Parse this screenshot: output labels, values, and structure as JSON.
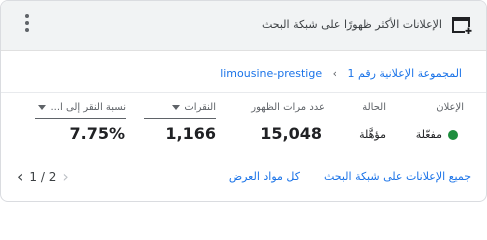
{
  "header": {
    "title": "الإعلانات الأكثر ظهورًا على شبكة البحث",
    "icon": "add-to-queue-icon"
  },
  "breadcrumb": {
    "campaign": "limousine-prestige",
    "separator": "›",
    "ad_group": "المجموعة الإعلانية رقم 1"
  },
  "columns": {
    "ad": "الإعلان",
    "status": "الحالة",
    "impressions": "عدد مرات الظهور",
    "clicks": "النقرات",
    "ctr": "نسبة النقر إلى ا..."
  },
  "row": {
    "ad_status": "مفعّلة",
    "status": "مؤهَّلة",
    "impressions": "15,048",
    "clicks": "1,166",
    "ctr": "7.75%"
  },
  "footer": {
    "all_search_ads": "جميع الإعلانات على شبكة البحث",
    "all_assets": "كل مواد العرض",
    "pager": "1 / 2"
  },
  "colors": {
    "link": "#1a73e8",
    "status_dot": "#1e8e3e",
    "header_bg": "#f1f3f4"
  }
}
